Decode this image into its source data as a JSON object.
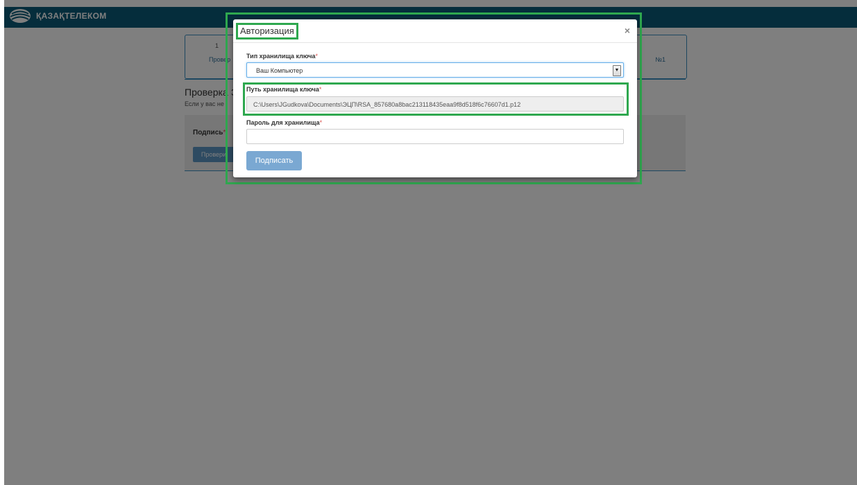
{
  "header": {
    "brand": "ҚАЗАҚТЕЛЕКОМ"
  },
  "background": {
    "step_number": "1",
    "step_label": "Провер",
    "step_right_label": "№1",
    "section_title": "Проверка Э",
    "section_subtitle": "Если у вас не",
    "sign_label": "Подпись",
    "sign_button": "Провери"
  },
  "modal": {
    "title": "Авторизация",
    "close": "×",
    "storage_type_label": "Тип хранилища ключа",
    "storage_type_value": "Ваш Компьютер",
    "storage_path_label": "Путь хранилища ключа",
    "storage_path_value": "C:\\Users\\JGudkova\\Documents\\ЭЦП\\RSA_857680a8bac213118435eaa9f8d518f6c76607d1.p12",
    "password_label": "Пароль для хранилища",
    "password_value": "",
    "submit": "Подписать",
    "required_mark": "*"
  },
  "colors": {
    "topbar": "#0b5a78",
    "highlight": "#2fa84f",
    "button": "#7aa8d2",
    "required": "#d9534f"
  }
}
